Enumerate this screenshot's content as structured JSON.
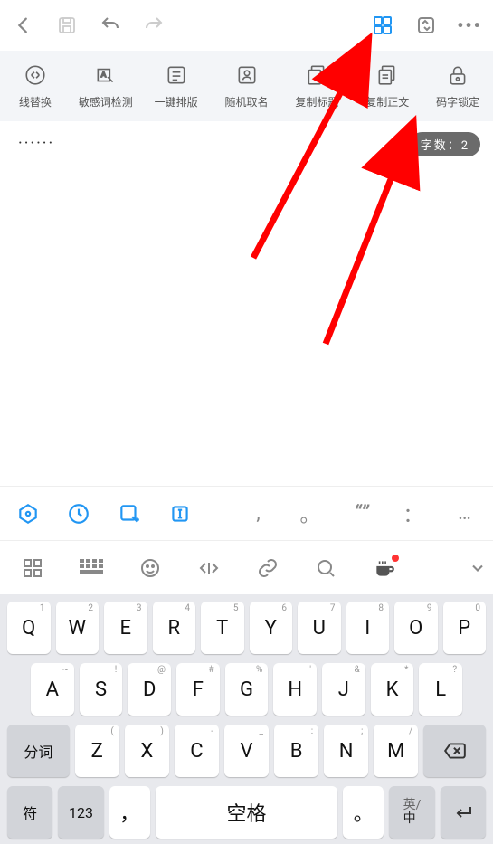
{
  "toolbar": [
    {
      "id": "replace",
      "label": "线替换"
    },
    {
      "id": "sensitive",
      "label": "敏感词检测"
    },
    {
      "id": "layout",
      "label": "一键排版"
    },
    {
      "id": "random-name",
      "label": "随机取名"
    },
    {
      "id": "copy-title",
      "label": "复制标题"
    },
    {
      "id": "copy-body",
      "label": "复制正文"
    },
    {
      "id": "lock",
      "label": "码字锁定"
    }
  ],
  "editor_text": "······",
  "word_count_label": "字数：2",
  "punct_row": [
    ",",
    "。",
    "\"\"",
    "：",
    "…"
  ],
  "keyboard": {
    "row1": [
      {
        "k": "Q",
        "s": "1"
      },
      {
        "k": "W",
        "s": "2"
      },
      {
        "k": "E",
        "s": "3"
      },
      {
        "k": "R",
        "s": "4"
      },
      {
        "k": "T",
        "s": "5"
      },
      {
        "k": "Y",
        "s": "6"
      },
      {
        "k": "U",
        "s": "7"
      },
      {
        "k": "I",
        "s": "8"
      },
      {
        "k": "O",
        "s": "9"
      },
      {
        "k": "P",
        "s": "0"
      }
    ],
    "row2": [
      {
        "k": "A",
        "s": "~"
      },
      {
        "k": "S",
        "s": "!"
      },
      {
        "k": "D",
        "s": "@"
      },
      {
        "k": "F",
        "s": "#"
      },
      {
        "k": "G",
        "s": "%"
      },
      {
        "k": "H",
        "s": "'"
      },
      {
        "k": "J",
        "s": "&"
      },
      {
        "k": "K",
        "s": "*"
      },
      {
        "k": "L",
        "s": "?"
      }
    ],
    "row3": [
      {
        "k": "Z",
        "s": "("
      },
      {
        "k": "X",
        "s": ")"
      },
      {
        "k": "C",
        "s": "-"
      },
      {
        "k": "V",
        "s": "_"
      },
      {
        "k": "B",
        "s": ":"
      },
      {
        "k": "N",
        "s": ";"
      },
      {
        "k": "M",
        "s": "/"
      }
    ],
    "fenci": "分词",
    "fu": "符",
    "num": "123",
    "comma": "，",
    "space": "空格",
    "period": "。",
    "lang_en": "英",
    "lang_zh": "中"
  }
}
